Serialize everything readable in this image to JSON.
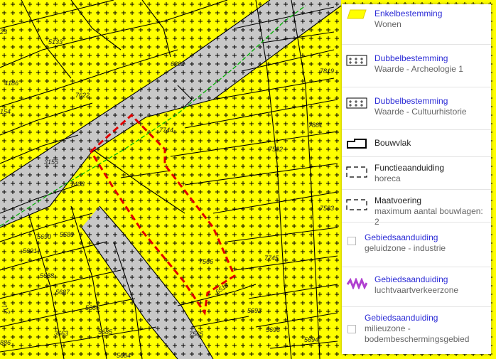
{
  "map": {
    "parcel_numbers": [
      "5133",
      "4186",
      "7622",
      "6292",
      "7819",
      "7881",
      "7744",
      "7582",
      "3155",
      "7403",
      "7583",
      "5690",
      "5689",
      "5691",
      "7566",
      "7745",
      "5688",
      "5687",
      "5686",
      "6518",
      "5692",
      "3663",
      "5685",
      "7565",
      "5693",
      "5694",
      "5684",
      "154",
      "23",
      "886",
      "712"
    ]
  },
  "legend": {
    "items": [
      {
        "title": "Enkelbestemming",
        "sub": "Wonen",
        "icon": "yellow-parallelogram-icon",
        "color": "#ffff00"
      },
      {
        "title": "Dubbelbestemming",
        "sub": "Waarde - Archeologie 1",
        "icon": "cross-hatch-icon"
      },
      {
        "title": "Dubbelbestemming",
        "sub": "Waarde - Cultuurhistorie",
        "icon": "cross-hatch-icon"
      },
      {
        "title": "Bouwvlak",
        "sub": "",
        "icon": "building-outline-icon"
      },
      {
        "title": "Functieaanduiding",
        "sub": "horeca",
        "icon": "dashed-box-icon"
      },
      {
        "title": "Maatvoering",
        "sub": "maximum aantal bouwlagen: 2",
        "icon": "dashed-box-icon"
      },
      {
        "title": "Gebiedsaanduiding",
        "sub": "geluidzone - industrie",
        "icon": "broken-image-icon"
      },
      {
        "title": "Gebiedsaanduiding",
        "sub": "luchtvaartverkeerzone",
        "icon": "purple-zigzag-icon",
        "color": "#b040d0"
      },
      {
        "title": "Gebiedsaanduiding",
        "sub": "milieuzone - bodembeschermingsgebied",
        "icon": "broken-image-icon"
      }
    ]
  },
  "colors": {
    "wonen": "#ffff00",
    "road": "#c8c8c8",
    "plot_outline": "#e00000",
    "green_line": "#00b000",
    "link": "#2b2bd6"
  }
}
